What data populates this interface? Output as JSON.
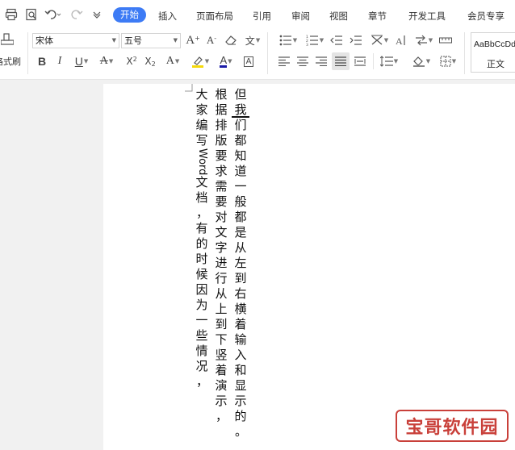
{
  "menubar": {
    "tabs": [
      "开始",
      "插入",
      "页面布局",
      "引用",
      "审阅",
      "视图",
      "章节",
      "开发工具",
      "会员专享"
    ],
    "active_tab": "开始"
  },
  "ribbon": {
    "format_painter_label": "格式刷",
    "font_name": "宋体",
    "font_size": "五号",
    "style_preview": "AaBbCcDd",
    "style_name": "正文"
  },
  "document": {
    "columns": [
      "但我们都知道一般都是从左到右横着输入和显示的。",
      "根据排版要求需要对文字进行从上到下竖着演示，",
      "大家编写Word文档，有的时候因为一些情况，"
    ]
  },
  "watermark": {
    "text": "宝哥软件园"
  },
  "colors": {
    "accent": "#3d7bf5",
    "watermark": "#c9403a",
    "highlight": "#f5d90a",
    "font_color": "#1a1aa6"
  }
}
